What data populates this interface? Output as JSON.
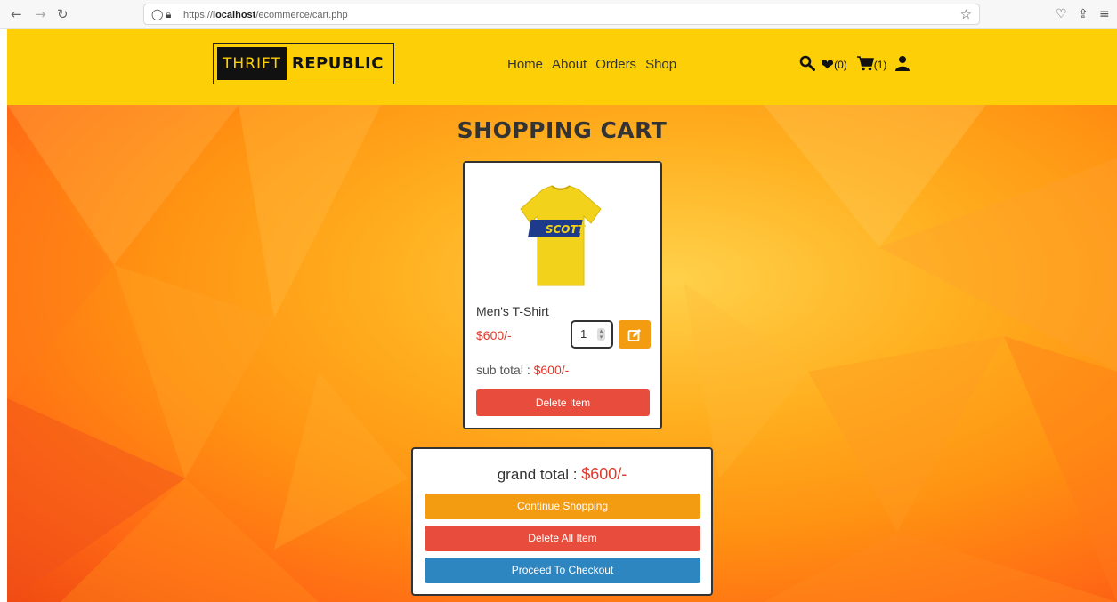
{
  "browser": {
    "url_prefix": "https://",
    "url_host": "localhost",
    "url_path": "/ecommerce/cart.php"
  },
  "header": {
    "logo_part1": "THRIFT",
    "logo_part2": "REPUBLIC",
    "nav": [
      "Home",
      "About",
      "Orders",
      "Shop"
    ],
    "wishlist_count": "(0)",
    "cart_count": "(1)"
  },
  "page": {
    "title": "SHOPPING CART"
  },
  "cart_items": [
    {
      "name": "Men's T-Shirt",
      "price": "$600/-",
      "quantity": "1",
      "subtotal_label": "sub total :",
      "subtotal": "$600/-",
      "delete_label": "Delete Item",
      "image_text": "SCOTT"
    }
  ],
  "summary": {
    "grand_total_label": "grand total :",
    "grand_total": "$600/-",
    "continue_label": "Continue Shopping",
    "delete_all_label": "Delete All Item",
    "checkout_label": "Proceed To Checkout"
  },
  "colors": {
    "header_bg": "#fccf06",
    "price_red": "#e0392b",
    "orange_button": "#f39c12",
    "red_button": "#e74c3c",
    "blue_button": "#2e86c1"
  }
}
